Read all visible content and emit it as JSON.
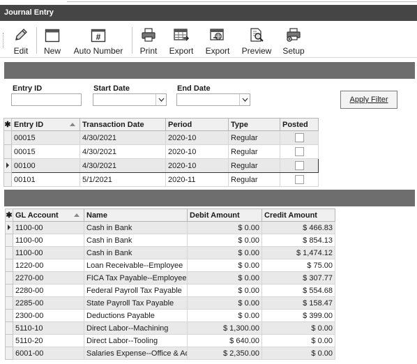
{
  "window": {
    "title": "Journal Entry"
  },
  "toolbar": {
    "buttons": [
      {
        "id": "edit",
        "label": "Edit",
        "icon": "pencil-icon"
      },
      {
        "id": "new",
        "label": "New",
        "icon": "new-window-icon"
      },
      {
        "id": "auto_number",
        "label": "Auto Number",
        "icon": "hash-icon"
      },
      {
        "id": "print",
        "label": "Print",
        "icon": "printer-icon"
      },
      {
        "id": "export1",
        "label": "Export",
        "icon": "export-table-icon"
      },
      {
        "id": "export2",
        "label": "Export",
        "icon": "export-globe-icon"
      },
      {
        "id": "preview",
        "label": "Preview",
        "icon": "preview-icon"
      },
      {
        "id": "setup",
        "label": "Setup",
        "icon": "setup-printer-icon"
      }
    ]
  },
  "filters": {
    "entry_id_label": "Entry ID",
    "entry_id_value": "",
    "start_date_label": "Start Date",
    "start_date_value": "",
    "end_date_label": "End Date",
    "end_date_value": "",
    "apply_label": "Apply Filter"
  },
  "journal_grid": {
    "columns": [
      "Entry ID",
      "Transaction Date",
      "Period",
      "Type",
      "Posted"
    ],
    "rows": [
      {
        "entry_id": "00015",
        "date": "4/30/2021",
        "period": "2020-10",
        "type": "Regular",
        "posted": false
      },
      {
        "entry_id": "00015",
        "date": "4/30/2021",
        "period": "2020-10",
        "type": "Regular",
        "posted": false
      },
      {
        "entry_id": "00100",
        "date": "4/30/2021",
        "period": "2020-10",
        "type": "Regular",
        "posted": false
      },
      {
        "entry_id": "00101",
        "date": "5/1/2021",
        "period": "2020-11",
        "type": "Regular",
        "posted": false
      }
    ],
    "current_row": 2
  },
  "detail_grid": {
    "columns": [
      "GL Account",
      "Name",
      "Debit Amount",
      "Credit Amount"
    ],
    "rows": [
      {
        "account": "1100-00",
        "name": "Cash in Bank",
        "debit": "$ 0.00",
        "credit": "$ 466.83"
      },
      {
        "account": "1100-00",
        "name": "Cash in Bank",
        "debit": "$ 0.00",
        "credit": "$ 854.13"
      },
      {
        "account": "1100-00",
        "name": "Cash in Bank",
        "debit": "$ 0.00",
        "credit": "$ 1,474.12"
      },
      {
        "account": "1220-00",
        "name": "Loan Receivable--Employee",
        "debit": "$ 0.00",
        "credit": "$ 75.00"
      },
      {
        "account": "2270-00",
        "name": "FICA Tax Payable--Employee",
        "debit": "$ 0.00",
        "credit": "$ 307.77"
      },
      {
        "account": "2280-00",
        "name": "Federal Payroll Tax Payable",
        "debit": "$ 0.00",
        "credit": "$ 554.68"
      },
      {
        "account": "2285-00",
        "name": "State Payroll Tax Payable",
        "debit": "$ 0.00",
        "credit": "$ 158.47"
      },
      {
        "account": "2300-00",
        "name": "Deductions Payable",
        "debit": "$ 0.00",
        "credit": "$ 399.00"
      },
      {
        "account": "5110-10",
        "name": "Direct Labor--Machining",
        "debit": "$ 1,300.00",
        "credit": "$ 0.00"
      },
      {
        "account": "5110-20",
        "name": "Direct Labor--Tooling",
        "debit": "$ 640.00",
        "credit": "$ 0.00"
      },
      {
        "account": "6001-00",
        "name": "Salaries Expense--Office & Admin",
        "debit": "$ 2,350.00",
        "credit": "$ 0.00"
      }
    ],
    "current_row": 0
  },
  "colors": {
    "title_bar": "#454545",
    "section_band": "#6e6e6e",
    "alt_row": "#e9e9e9"
  }
}
